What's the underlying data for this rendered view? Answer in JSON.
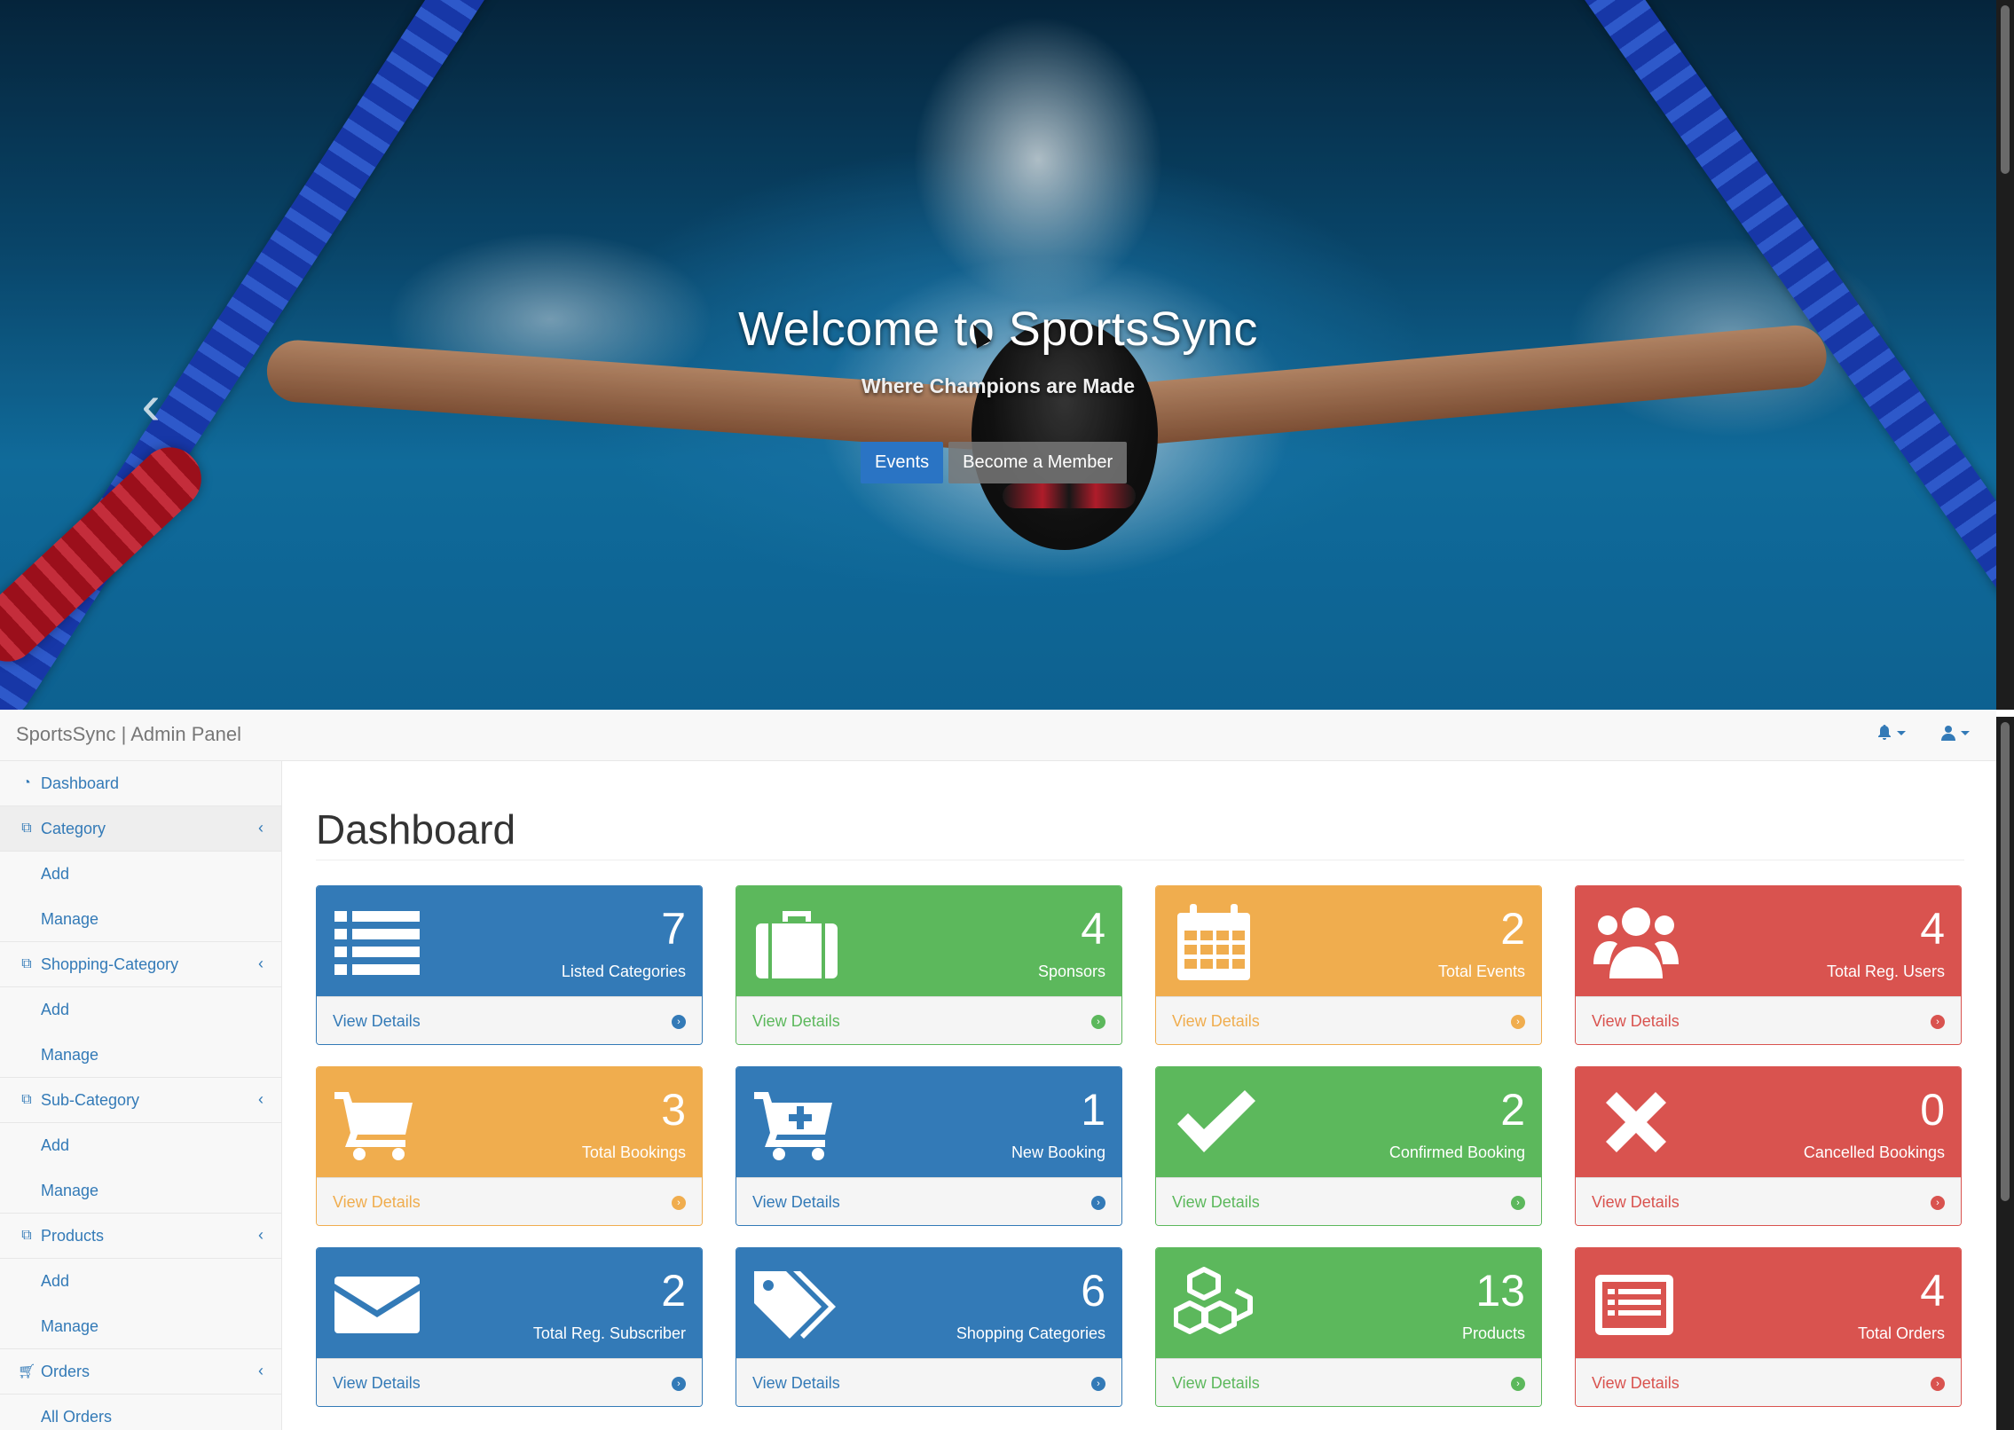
{
  "hero": {
    "title": "Welcome to SportsSync",
    "subtitle": "Where Champions are Made",
    "buttons": {
      "events": "Events",
      "member": "Become a Member"
    },
    "carousel_prev": "‹"
  },
  "admin": {
    "brand": "SportsSync | Admin Panel",
    "page_title": "Dashboard",
    "sidebar": {
      "dashboard": "Dashboard",
      "category": {
        "label": "Category",
        "add": "Add",
        "manage": "Manage"
      },
      "shopping_category": {
        "label": "Shopping-Category",
        "add": "Add",
        "manage": "Manage"
      },
      "sub_category": {
        "label": "Sub-Category",
        "add": "Add",
        "manage": "Manage"
      },
      "products": {
        "label": "Products",
        "add": "Add",
        "manage": "Manage"
      },
      "orders": {
        "label": "Orders",
        "all_orders": "All Orders"
      }
    },
    "view_details": "View Details",
    "cards": [
      {
        "count": "7",
        "label": "Listed Categories",
        "color": "#337ab7",
        "icon": "list-icon"
      },
      {
        "count": "4",
        "label": "Sponsors",
        "color": "#5cb85c",
        "icon": "briefcase-icon"
      },
      {
        "count": "2",
        "label": "Total Events",
        "color": "#f0ad4e",
        "icon": "calendar-icon"
      },
      {
        "count": "4",
        "label": "Total Reg. Users",
        "color": "#d9534f",
        "icon": "users-icon"
      },
      {
        "count": "3",
        "label": "Total Bookings",
        "color": "#f0ad4e",
        "icon": "cart-icon"
      },
      {
        "count": "1",
        "label": "New Booking",
        "color": "#337ab7",
        "icon": "cart-plus-icon"
      },
      {
        "count": "2",
        "label": "Confirmed Booking",
        "color": "#5cb85c",
        "icon": "check-icon"
      },
      {
        "count": "0",
        "label": "Cancelled Bookings",
        "color": "#d9534f",
        "icon": "times-icon"
      },
      {
        "count": "2",
        "label": "Total Reg. Subscriber",
        "color": "#337ab7",
        "icon": "envelope-icon"
      },
      {
        "count": "6",
        "label": "Shopping Categories",
        "color": "#337ab7",
        "icon": "tags-icon"
      },
      {
        "count": "13",
        "label": "Products",
        "color": "#5cb85c",
        "icon": "cubes-icon"
      },
      {
        "count": "4",
        "label": "Total Orders",
        "color": "#d9534f",
        "icon": "list-alt-icon"
      }
    ]
  }
}
